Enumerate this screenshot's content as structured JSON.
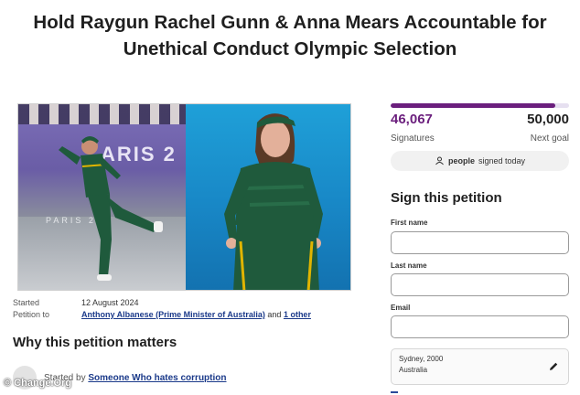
{
  "headline": {
    "line1": "Hold Raygun Rachel Gunn & Anna Mears Accountable for",
    "line2": "Unethical Conduct Olympic Selection"
  },
  "photo": {
    "venue_text": "ARIS 2",
    "floor_text": "PARIS 2"
  },
  "meta": {
    "started_label": "Started",
    "started_value": "12 August 2024",
    "petition_to_label": "Petition to",
    "petition_to_target": "Anthony Albanese (Prime Minister of Australia)",
    "petition_to_and": "and",
    "petition_to_other": "1 other"
  },
  "section": {
    "why_title": "Why this petition matters",
    "started_by_prefix": "Started by",
    "started_by_name": "Someone Who hates corruption"
  },
  "watermark": "© Change.Org",
  "progress": {
    "signatures": "46,067",
    "signatures_label": "Signatures",
    "goal": "50,000",
    "goal_label": "Next goal",
    "fraction": 0.921
  },
  "today": {
    "bold": "people",
    "rest": "signed today"
  },
  "sign_form": {
    "title": "Sign this petition",
    "first_name_label": "First name",
    "first_name_value": "",
    "last_name_label": "Last name",
    "last_name_value": "",
    "email_label": "Email",
    "email_value": "",
    "location_line1": "Sydney, 2000",
    "location_line2": "Australia"
  },
  "colors": {
    "accent": "#6b1f7d",
    "link": "#1b3a8a",
    "jersey_green": "#1f5a3c",
    "jersey_gold": "#e0b400"
  },
  "icons": {
    "today": "people-group-icon",
    "edit": "pencil-icon"
  }
}
